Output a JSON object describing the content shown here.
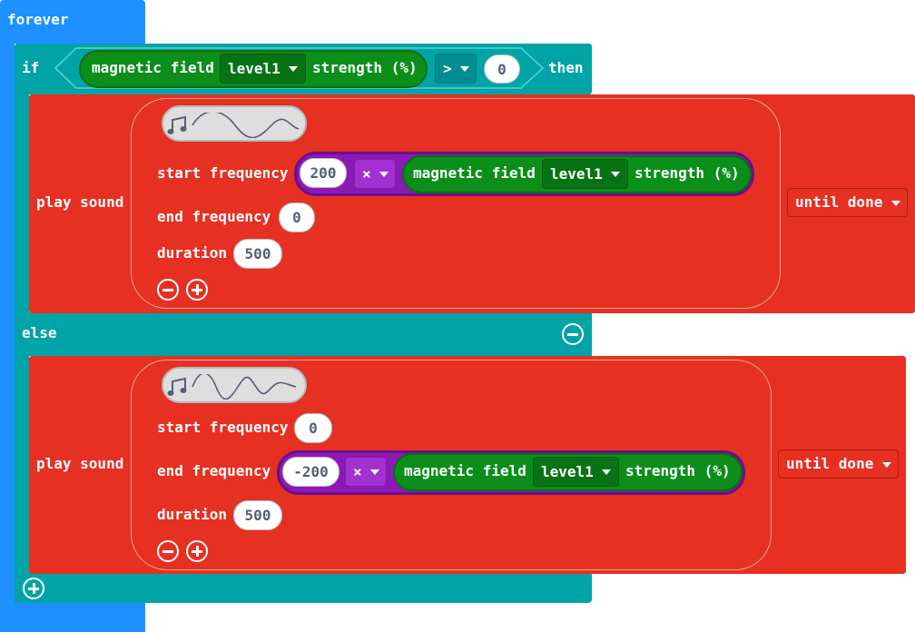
{
  "forever": {
    "label": "forever"
  },
  "if_block": {
    "if_label": "if",
    "then_label": "then",
    "else_label": "else",
    "condition": {
      "sensor_label": "magnetic field",
      "axis_value": "level1",
      "strength_label": "strength (%)",
      "operator": ">",
      "compare_value": "0"
    }
  },
  "sound1": {
    "label": "play sound",
    "start_label": "start frequency",
    "start_value": "200",
    "multiply_op": "×",
    "sensor_label": "magnetic field",
    "axis_value": "level1",
    "strength_label": "strength (%)",
    "end_label": "end frequency",
    "end_value": "0",
    "duration_label": "duration",
    "duration_value": "500",
    "mode": "until done"
  },
  "sound2": {
    "label": "play sound",
    "start_label": "start frequency",
    "start_value": "0",
    "end_label": "end frequency",
    "end_value": "-200",
    "multiply_op": "×",
    "sensor_label": "magnetic field",
    "axis_value": "level1",
    "strength_label": "strength (%)",
    "duration_label": "duration",
    "duration_value": "500",
    "mode": "until done"
  },
  "icons": {
    "music_note": "music-note-icon",
    "waveform": "waveform-icon",
    "minus": "minus-circle-icon",
    "plus": "plus-circle-icon",
    "dropdown": "chevron-down-icon"
  },
  "colors": {
    "loops": "#1e90ff",
    "logic": "#00a4a6",
    "music": "#e63022",
    "input": "#0b8f1a",
    "math": "#8d18b8"
  }
}
